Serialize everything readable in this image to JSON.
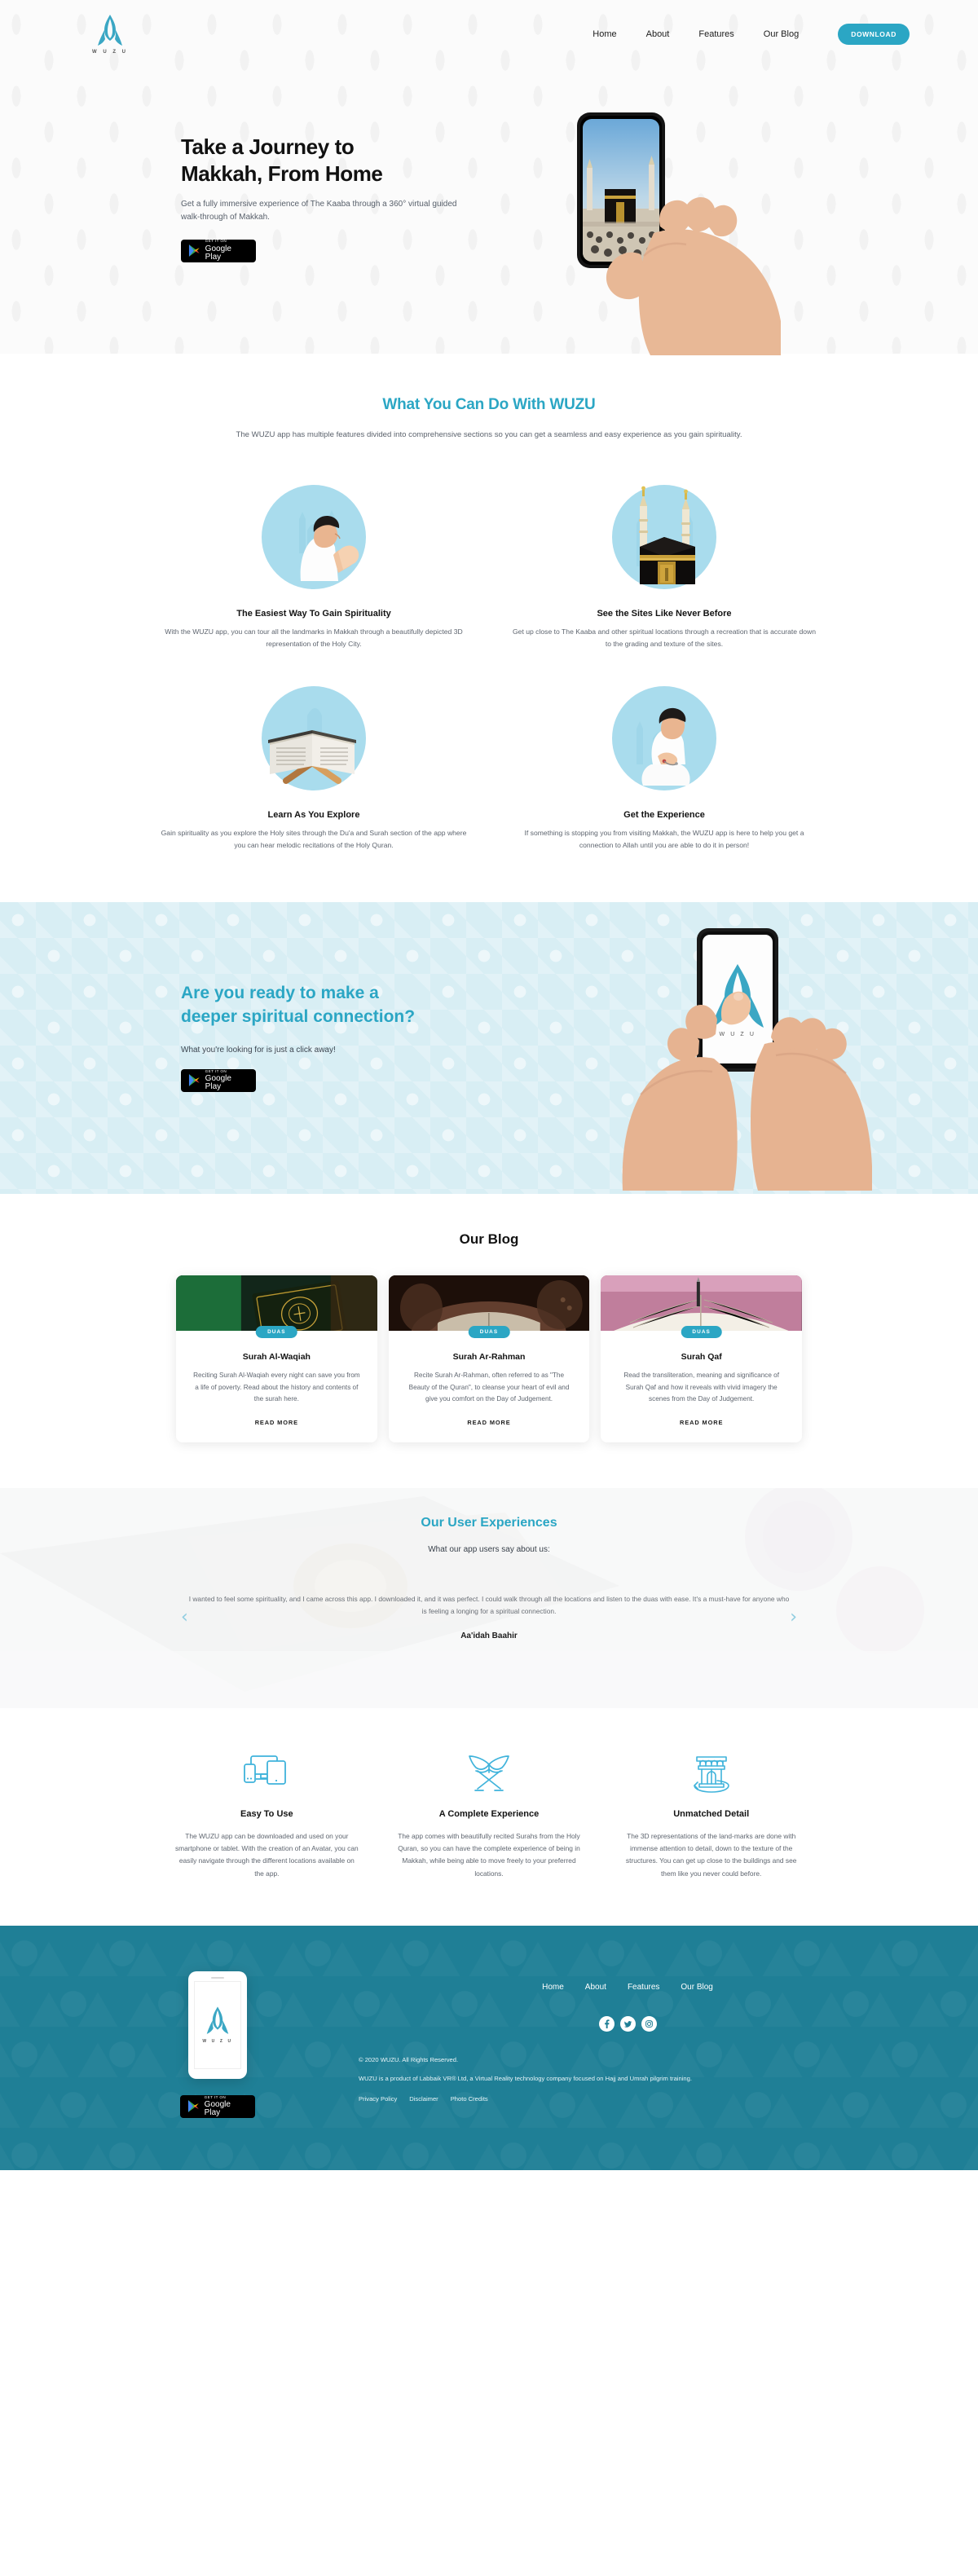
{
  "brand": {
    "name": "WUZU",
    "wordmark": "W U Z U"
  },
  "header": {
    "nav": [
      {
        "label": "Home"
      },
      {
        "label": "About"
      },
      {
        "label": "Features"
      },
      {
        "label": "Our Blog"
      }
    ],
    "download_label": "DOWNLOAD"
  },
  "hero": {
    "title_line1": "Take a Journey to",
    "title_line2": "Makkah, From Home",
    "subtitle": "Get a fully immersive experience of The Kaaba through a 360° virtual guided walk-through of Makkah.",
    "store_small": "GET IT ON",
    "store_big": "Google Play"
  },
  "features": {
    "title": "What You Can Do With WUZU",
    "subtitle": "The WUZU app has multiple features divided into comprehensive sections so you can get a seamless and easy experience as you gain spirituality.",
    "cards": [
      {
        "icon": "praying-man-icon",
        "title": "The Easiest Way To Gain Spirituality",
        "text": "With the WUZU app, you can tour all the landmarks in Makkah through a beautifully depicted 3D representation of the Holy City."
      },
      {
        "icon": "kaaba-icon",
        "title": "See the Sites Like Never Before",
        "text": "Get up close to The Kaaba and other spiritual locations through a recreation that is accurate down to the grading and texture of the sites."
      },
      {
        "icon": "quran-stand-icon",
        "title": "Learn As You Explore",
        "text": "Gain spirituality as you explore the Holy sites through the Du'a and Surah section of the app where you can hear melodic recitations of the Holy Quran."
      },
      {
        "icon": "kneeling-prayer-icon",
        "title": "Get the Experience",
        "text": "If something is stopping you from visiting Makkah, the WUZU app is here to help you get a connection to Allah until you are able to do it in person!"
      }
    ]
  },
  "cta": {
    "title_line1": "Are you ready to make a",
    "title_line2": "deeper spiritual connection?",
    "subtitle": "What you're looking for is just a click away!",
    "store_small": "GET IT ON",
    "store_big": "Google Play"
  },
  "blog": {
    "title": "Our Blog",
    "posts": [
      {
        "tag": "DUAS",
        "title": "Surah Al-Waqiah",
        "text": "Reciting Surah Al-Waqiah every night can save you from a life of poverty. Read about the history and contents of the surah here.",
        "read_more": "READ MORE",
        "thumb_colors": [
          "#1d3a2a",
          "#0d1a12"
        ]
      },
      {
        "tag": "DUAS",
        "title": "Surah Ar-Rahman",
        "text": "Recite Surah Ar-Rahman, often referred to as \"The Beauty of the Quran\", to cleanse your heart of evil and give you comfort on the Day of Judgement.",
        "read_more": "READ MORE",
        "thumb_colors": [
          "#5c3a2c",
          "#1a0f0a"
        ]
      },
      {
        "tag": "DUAS",
        "title": "Surah Qaf",
        "text": "Read the transliteration, meaning and significance of Surah Qaf and how it reveals with vivid imagery the scenes from the Day of Judgement.",
        "read_more": "READ MORE",
        "thumb_colors": [
          "#b16a8a",
          "#2a1a22"
        ]
      }
    ]
  },
  "testimonials": {
    "title": "Our User Experiences",
    "subtitle": "What our app users say about us:",
    "quote": "I wanted to feel some spirituality, and I came across this app. I downloaded it, and it was perfect. I could walk through all the locations and listen to the duas with ease. It's a must-have for anyone who is feeling a longing for a spiritual connection.",
    "author": "Aa'idah Baahir",
    "prev": "‹",
    "next": "›"
  },
  "why": {
    "cards": [
      {
        "icon": "devices-icon",
        "title": "Easy To Use",
        "text": "The WUZU app can be downloaded and used on your smartphone or tablet. With the creation of an Avatar, you can easily navigate through the different locations available on the app."
      },
      {
        "icon": "quran-rehal-icon",
        "title": "A Complete Experience",
        "text": "The app comes with beautifully recited Surahs from the Holy Quran, so you can have the complete experience of being in Makkah, while being able to move freely to your preferred locations."
      },
      {
        "icon": "landmark-3d-icon",
        "title": "Unmatched Detail",
        "text": "The 3D representations of the land-marks are done with immense attention to detail, down to the texture of the structures. You can get up close to the buildings and see them like you never could before."
      }
    ]
  },
  "footer": {
    "nav": [
      {
        "label": "Home"
      },
      {
        "label": "About"
      },
      {
        "label": "Features"
      },
      {
        "label": "Our Blog"
      }
    ],
    "social": [
      {
        "name": "facebook-icon",
        "glyph": "f"
      },
      {
        "name": "twitter-icon",
        "glyph": "t"
      },
      {
        "name": "instagram-icon",
        "glyph": "i"
      }
    ],
    "copyright": "© 2020 WUZU. All Rights Reserved.",
    "description": "WUZU is a product of Labbaik VR® Ltd, a Virtual Reality technology company focused on Hajj and Umrah pilgrim training.",
    "links": [
      {
        "label": "Privacy Policy"
      },
      {
        "label": "Disclaimer"
      },
      {
        "label": "Photo Credits"
      }
    ],
    "store_small": "GET IT ON",
    "store_big": "Google Play",
    "wordmark": "W U Z U"
  },
  "colors": {
    "accent": "#2ba6c4",
    "footer_bg": "#1f7f96",
    "cta_bg": "#d8eef4",
    "circle_bg": "#a9dced"
  }
}
